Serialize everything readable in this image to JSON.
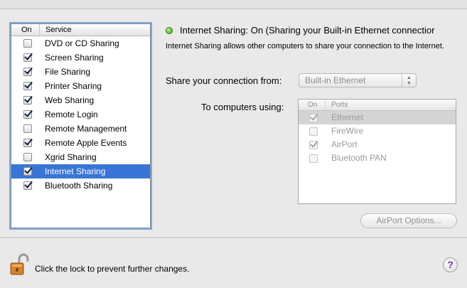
{
  "services_table": {
    "col_on": "On",
    "col_service": "Service",
    "rows": [
      {
        "label": "DVD or CD Sharing",
        "checked": false,
        "selected": false
      },
      {
        "label": "Screen Sharing",
        "checked": true,
        "selected": false
      },
      {
        "label": "File Sharing",
        "checked": true,
        "selected": false
      },
      {
        "label": "Printer Sharing",
        "checked": true,
        "selected": false
      },
      {
        "label": "Web Sharing",
        "checked": true,
        "selected": false
      },
      {
        "label": "Remote Login",
        "checked": true,
        "selected": false
      },
      {
        "label": "Remote Management",
        "checked": false,
        "selected": false
      },
      {
        "label": "Remote Apple Events",
        "checked": true,
        "selected": false
      },
      {
        "label": "Xgrid Sharing",
        "checked": false,
        "selected": false
      },
      {
        "label": "Internet Sharing",
        "checked": true,
        "selected": true
      },
      {
        "label": "Bluetooth Sharing",
        "checked": true,
        "selected": false
      }
    ]
  },
  "status": {
    "icon": "green-status-dot",
    "title": "Internet Sharing: On (Sharing your Built-in Ethernet connectior",
    "description": "Internet Sharing allows other computers to share your connection to the Internet."
  },
  "share_from": {
    "label": "Share your connection from:",
    "value": "Built-in Ethernet"
  },
  "to_computers": {
    "label": "To computers using:",
    "col_on": "On",
    "col_ports": "Ports",
    "ports": [
      {
        "label": "Ethernet",
        "checked": true,
        "selected": true
      },
      {
        "label": "FireWire",
        "checked": false,
        "selected": false
      },
      {
        "label": "AirPort",
        "checked": true,
        "selected": false
      },
      {
        "label": "Bluetooth PAN",
        "checked": false,
        "selected": false
      }
    ]
  },
  "airport_options_label": "AirPort Options...",
  "lock_text": "Click the lock to prevent further changes.",
  "help_label": "?",
  "colors": {
    "selection": "#3875d7",
    "status_green": "#35a11a"
  }
}
